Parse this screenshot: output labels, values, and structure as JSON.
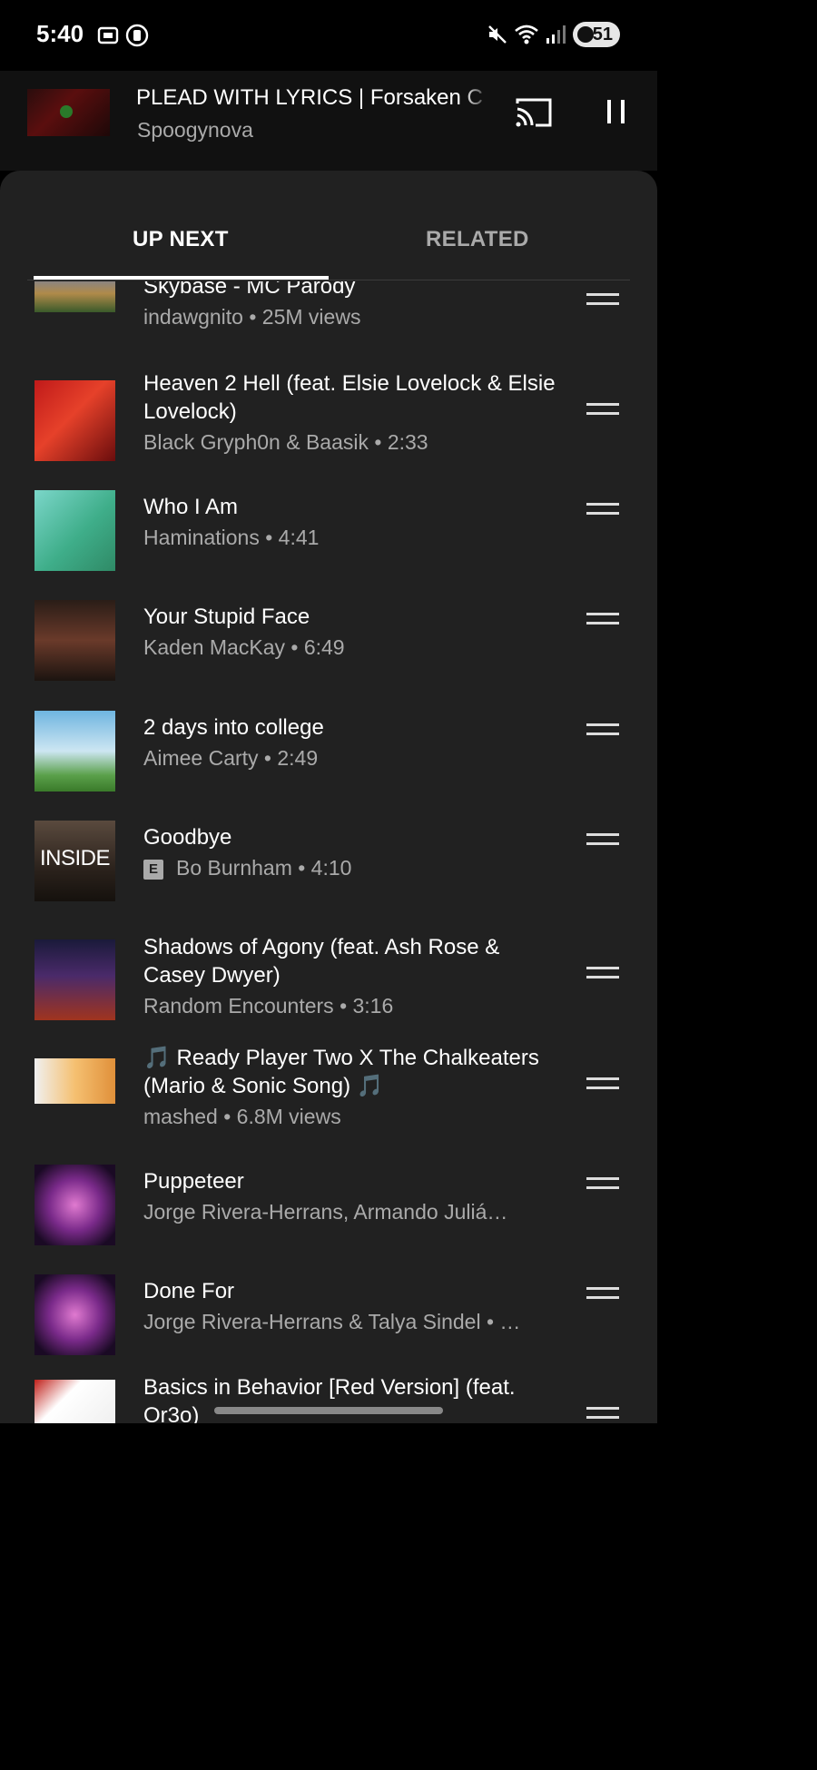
{
  "status": {
    "time": "5:40",
    "battery": "51"
  },
  "now_playing": {
    "title": "PLEAD WITH LYRICS | Forsaken C",
    "artist": "Spoogynova"
  },
  "tabs": {
    "up_next": "UP NEXT",
    "related": "RELATED"
  },
  "queue": [
    {
      "title": "Skybase - MC Parody",
      "subtitle": "indawgnito • 25M views"
    },
    {
      "title": "Heaven 2 Hell (feat. Elsie Lovelock & Elsie Lovelock)",
      "subtitle": "Black Gryph0n & Baasik • 2:33"
    },
    {
      "title": "Who I Am",
      "subtitle": "Haminations • 4:41"
    },
    {
      "title": "Your Stupid Face",
      "subtitle": "Kaden MacKay • 6:49"
    },
    {
      "title": "2 days into college",
      "subtitle": "Aimee Carty • 2:49"
    },
    {
      "title": "Goodbye",
      "subtitle": "Bo Burnham • 4:10",
      "explicit": "E",
      "thumb_text": "INSIDE"
    },
    {
      "title": "Shadows of Agony (feat. Ash Rose & Casey Dwyer)",
      "subtitle": "Random Encounters • 3:16"
    },
    {
      "title": "🎵 Ready Player Two X The Chalkeaters (Mario & Sonic Song) 🎵",
      "subtitle": "mashed • 6.8M views"
    },
    {
      "title": "Puppeteer",
      "subtitle": "Jorge Rivera-Herrans, Armando Juliá…"
    },
    {
      "title": "Done For",
      "subtitle": "Jorge Rivera-Herrans & Talya Sindel • …"
    },
    {
      "title": "Basics in Behavior [Red Version] (feat. Or3o)",
      "subtitle": ""
    }
  ]
}
